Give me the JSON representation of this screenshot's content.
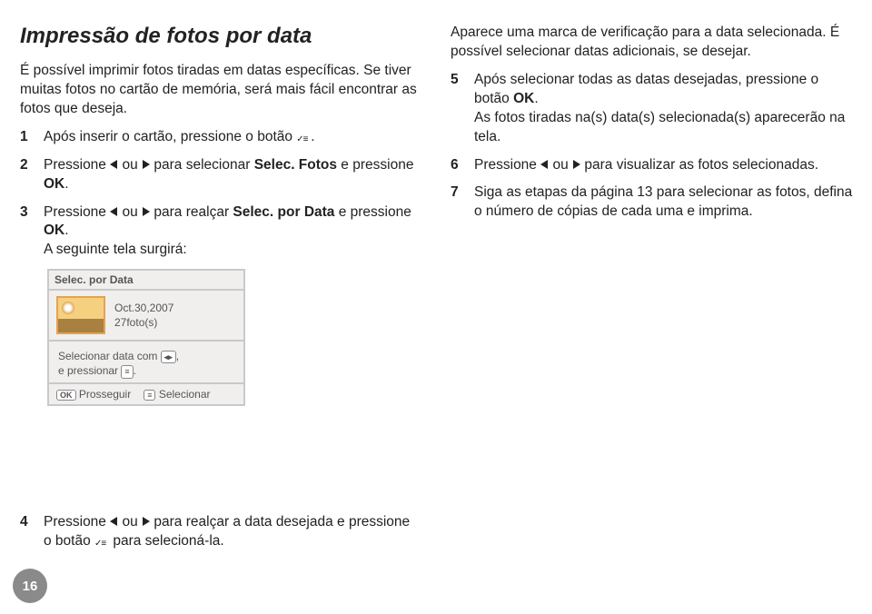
{
  "title": "Impressão de fotos por data",
  "intro": "É possível imprimir fotos tiradas em datas específicas. Se tiver muitas fotos no cartão de memória, será mais fácil encontrar as fotos que deseja.",
  "step1": {
    "n": "1",
    "a": "Após inserir o cartão, pressione o botão ",
    "b": "."
  },
  "step2": {
    "n": "2",
    "a": "Pressione ",
    "b": " ou ",
    "c": " para selecionar ",
    "d": "Selec. Fotos",
    "e": " e pressione ",
    "f": "OK",
    "g": "."
  },
  "step3": {
    "n": "3",
    "a": "Pressione ",
    "b": " ou ",
    "c": " para realçar ",
    "d": "Selec. por Data",
    "e": " e pressione ",
    "f": "OK",
    "g": "."
  },
  "step3tail": "A seguinte tela surgirá:",
  "screen": {
    "header": "Selec. por Data",
    "date": "Oct.30,2007",
    "count": "27foto(s)",
    "msg1": "Selecionar data com ",
    "msg2": ",",
    "msg3": "e pressionar ",
    "msg4": ".",
    "f1key": "OK",
    "f1txt": "Prosseguir",
    "f2key": "≡",
    "f2txt": "Selecionar"
  },
  "step4": {
    "n": "4",
    "a": "Pressione ",
    "b": " ou ",
    "c": " para realçar a data desejada e pressione o botão ",
    "d": " para selecioná-la."
  },
  "rightIntro": "Aparece uma marca de verificação para a data selecionada. É possível selecionar datas adicionais, se desejar.",
  "step5": {
    "n": "5",
    "a": "Após selecionar todas as datas desejadas, pressione o botão ",
    "b": "OK",
    "c": "."
  },
  "step5tail": "As fotos tiradas na(s) data(s) selecionada(s) aparecerão na tela.",
  "step6": {
    "n": "6",
    "a": "Pressione ",
    "b": " ou ",
    "c": " para visualizar as fotos selecionadas."
  },
  "step7": {
    "n": "7",
    "a": "Siga as etapas da página 13 para selecionar as fotos, defina o número de cópias de cada uma e imprima."
  },
  "pageNum": "16"
}
